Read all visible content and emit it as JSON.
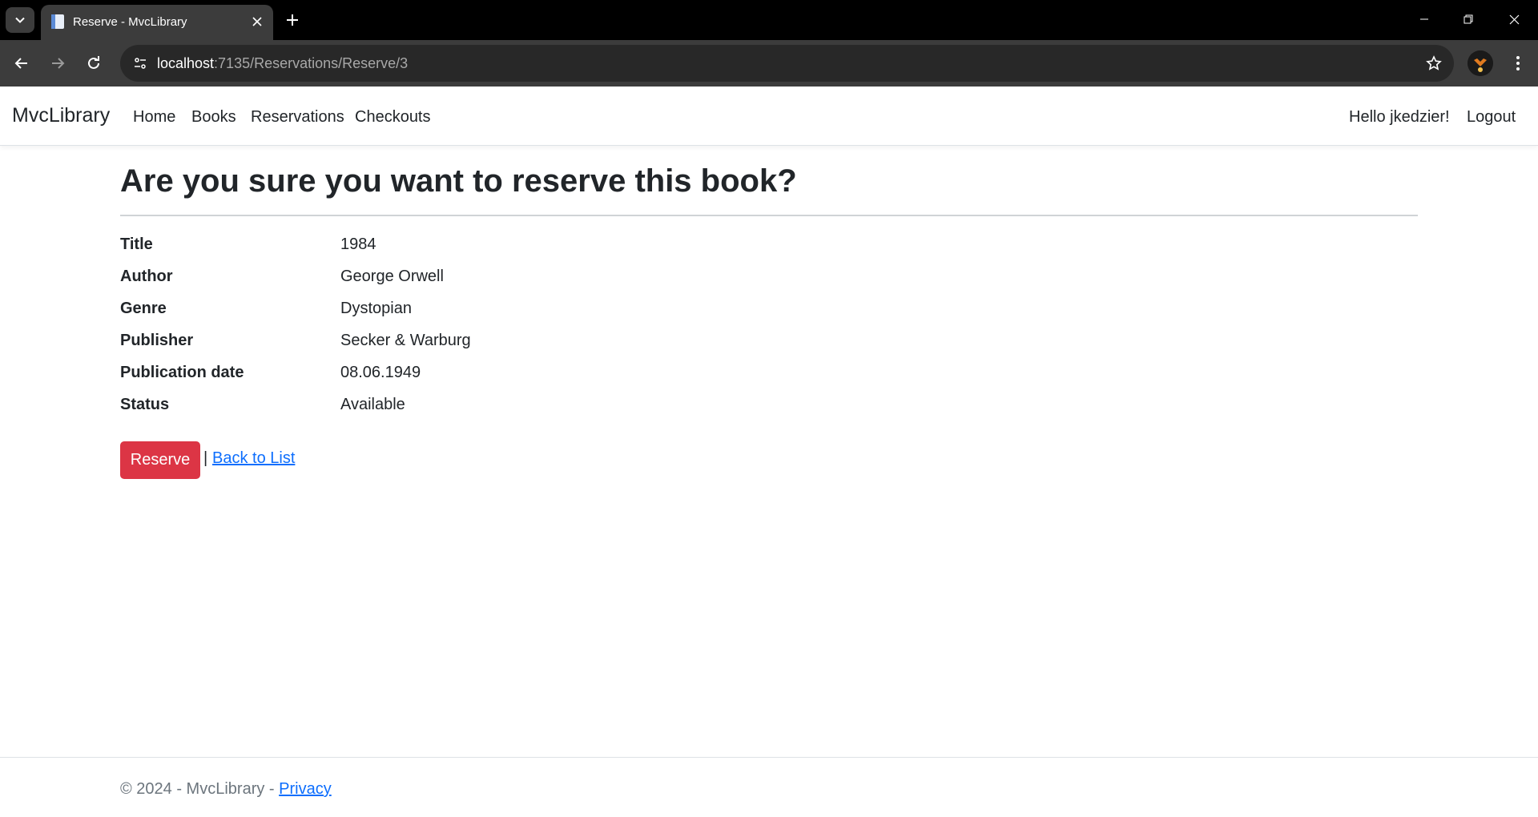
{
  "browser": {
    "tab_title": "Reserve - MvcLibrary",
    "url_host": "localhost",
    "url_path": ":7135/Reservations/Reserve/3"
  },
  "nav": {
    "brand": "MvcLibrary",
    "links": [
      "Home",
      "Books",
      "Reservations",
      "Checkouts"
    ],
    "greeting": "Hello jkedzier!",
    "logout": "Logout"
  },
  "page": {
    "heading": "Are you sure you want to reserve this book?",
    "details": [
      {
        "label": "Title",
        "value": "1984"
      },
      {
        "label": "Author",
        "value": "George Orwell"
      },
      {
        "label": "Genre",
        "value": "Dystopian"
      },
      {
        "label": "Publisher",
        "value": "Secker & Warburg"
      },
      {
        "label": "Publication date",
        "value": "08.06.1949"
      },
      {
        "label": "Status",
        "value": "Available"
      }
    ],
    "reserve_button": "Reserve",
    "separator": "|",
    "back_link": "Back to List"
  },
  "footer": {
    "copyright": "© 2024 - MvcLibrary - ",
    "privacy": "Privacy"
  },
  "colors": {
    "danger": "#dc3545",
    "link": "#0d6efd",
    "browser_dark": "#3c3c3c"
  }
}
